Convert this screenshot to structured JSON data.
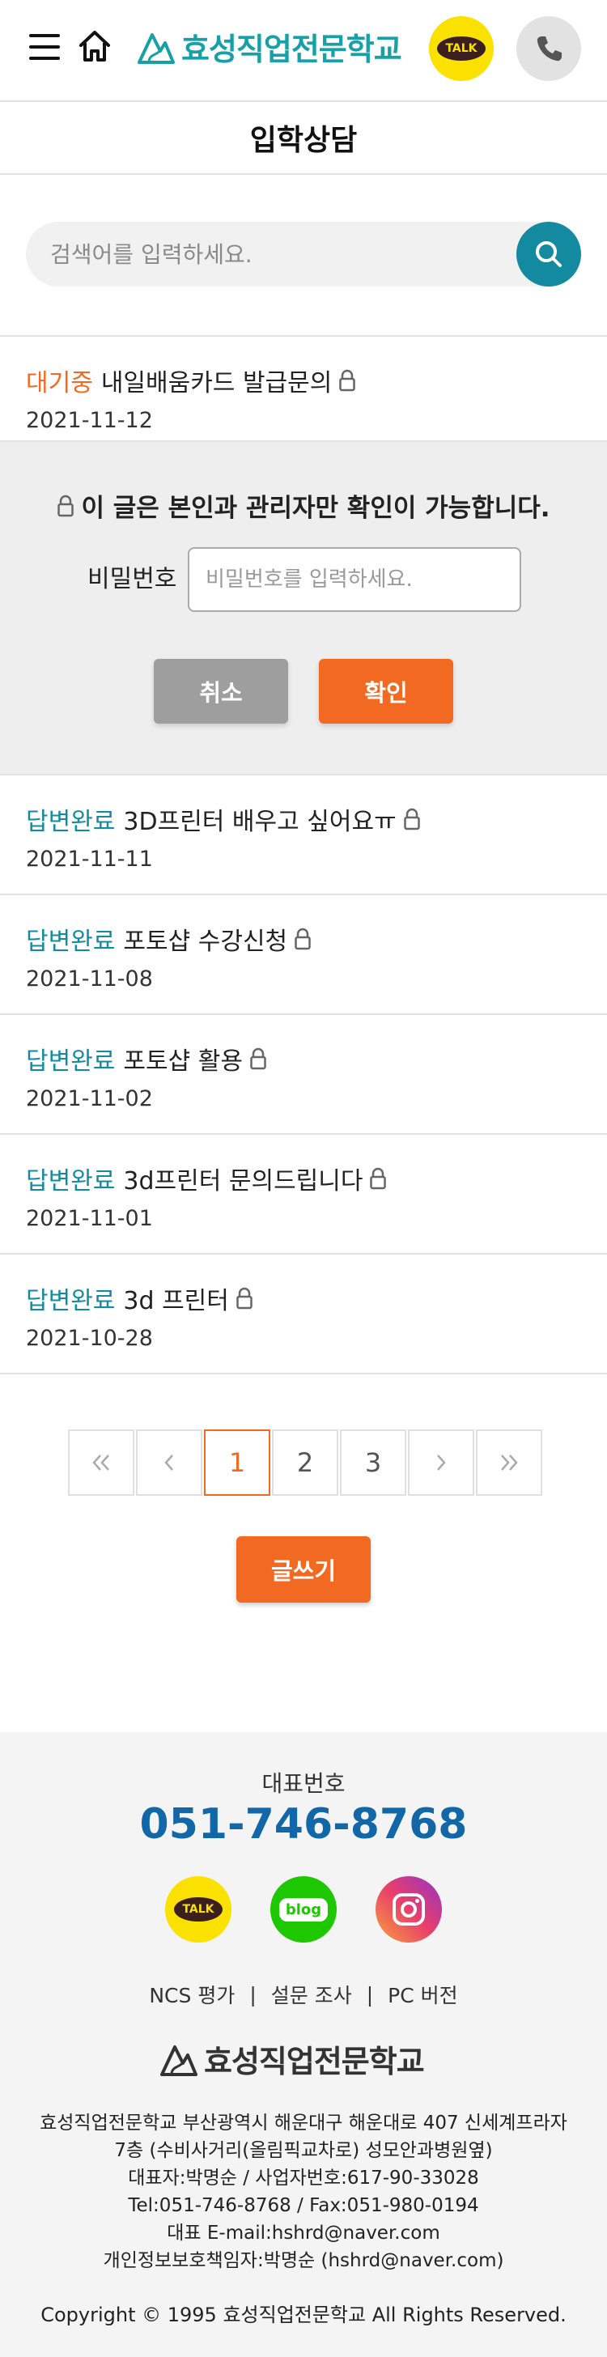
{
  "header": {
    "logo_text": "효성직업전문학교",
    "kakao_label": "TALK"
  },
  "page": {
    "title": "입학상담"
  },
  "search": {
    "placeholder": "검색어를 입력하세요."
  },
  "posts": [
    {
      "status": "대기중",
      "title": "내일배움카드 발급문의",
      "date": "2021-11-12"
    },
    {
      "status": "답변완료",
      "title": "3D프린터 배우고 싶어요ㅠ",
      "date": "2021-11-11"
    },
    {
      "status": "답변완료",
      "title": "포토샵 수강신청",
      "date": "2021-11-08"
    },
    {
      "status": "답변완료",
      "title": "포토샵 활용",
      "date": "2021-11-02"
    },
    {
      "status": "답변완료",
      "title": "3d프린터 문의드립니다",
      "date": "2021-11-01"
    },
    {
      "status": "답변완료",
      "title": "3d 프린터",
      "date": "2021-10-28"
    }
  ],
  "password_panel": {
    "notice": "이 글은 본인과 관리자만 확인이 가능합니다.",
    "label": "비밀번호",
    "placeholder": "비밀번호를 입력하세요.",
    "cancel": "취소",
    "confirm": "확인"
  },
  "pagination": {
    "pages": [
      "1",
      "2",
      "3"
    ],
    "current": "1",
    "write_label": "글쓰기"
  },
  "footer": {
    "rep_label": "대표번호",
    "rep_number": "051-746-8768",
    "kakao_label": "TALK",
    "blog_label": "blog",
    "links": [
      "NCS 평가",
      "설문 조사",
      "PC 버전"
    ],
    "link_separators": [
      "|",
      "|"
    ],
    "logo_text": "효성직업전문학교",
    "address_lines": [
      "효성직업전문학교 부산광역시 해운대구 해운대로 407 신세계프라자",
      "7층 (수비사거리(올림픽교차로) 성모안과병원옆)",
      "대표자:박명순 / 사업자번호:617-90-33028",
      "Tel:051-746-8768 / Fax:051-980-0194",
      "대표 E-mail:hshrd@naver.com",
      "개인정보보호책임자:박명순 (hshrd@naver.com)"
    ],
    "copyright": "Copyright © 1995 효성직업전문학교 All Rights Reserved."
  },
  "colors": {
    "accent_orange": "#f26a22",
    "accent_teal": "#148aa0",
    "logo_teal": "#17a0a6",
    "phone_blue": "#1167a8",
    "kakao_yellow": "#fae100"
  }
}
